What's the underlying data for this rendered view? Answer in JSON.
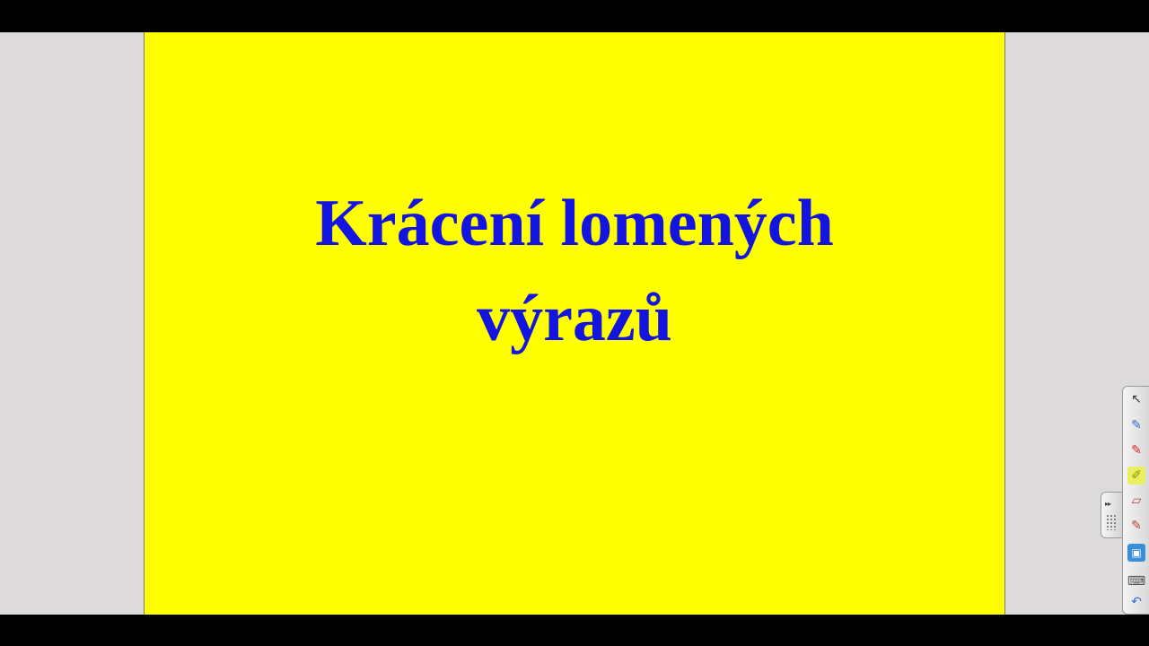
{
  "slide": {
    "title_line1": "Krácení lomených",
    "title_line2": "výrazů",
    "background_color": "#ffff00",
    "text_color": "#1414e0"
  },
  "toolbar": {
    "tools": [
      {
        "icon": "pointer-arrow-icon",
        "glyph": "↖"
      },
      {
        "icon": "pen-blue-icon",
        "glyph": "✎"
      },
      {
        "icon": "pen-red-icon",
        "glyph": "✎"
      },
      {
        "icon": "highlighter-icon",
        "glyph": "✐"
      },
      {
        "icon": "eraser-icon",
        "glyph": "▱"
      },
      {
        "icon": "shape-recognition-icon",
        "glyph": "✎"
      },
      {
        "icon": "notepad-icon",
        "glyph": "▣"
      },
      {
        "icon": "keyboard-icon",
        "glyph": "⌨"
      },
      {
        "icon": "undo-icon",
        "glyph": "↶"
      }
    ],
    "handle_glyph": "▸▸"
  }
}
